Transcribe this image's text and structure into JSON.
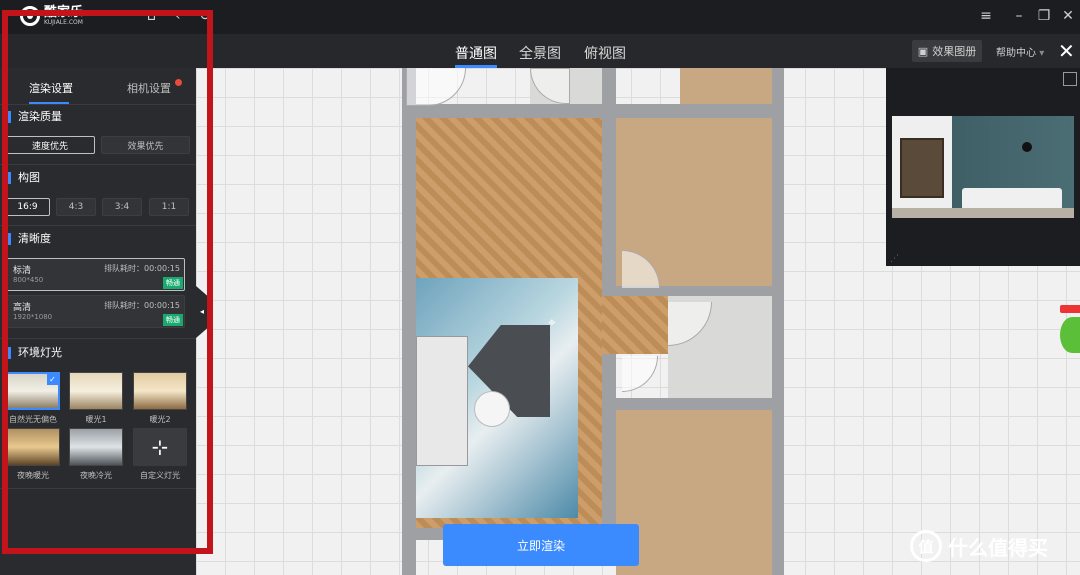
{
  "app": {
    "logo_cn": "酷家乐",
    "logo_en": "KUJIALE.COM"
  },
  "view_tabs": [
    {
      "label": "普通图",
      "active": true
    },
    {
      "label": "全景图",
      "active": false
    },
    {
      "label": "俯视图",
      "active": false
    }
  ],
  "toolbar": {
    "gallery_label": "效果图册",
    "help_label": "帮助中心"
  },
  "panel": {
    "tabs": [
      {
        "label": "渲染设置",
        "active": true
      },
      {
        "label": "相机设置",
        "active": false,
        "has_notification": true
      }
    ],
    "quality": {
      "title": "渲染质量",
      "options": [
        {
          "label": "速度优先",
          "active": true
        },
        {
          "label": "效果优先",
          "active": false
        }
      ]
    },
    "composition": {
      "title": "构图",
      "options": [
        {
          "label": "16:9",
          "active": true
        },
        {
          "label": "4:3",
          "active": false
        },
        {
          "label": "3:4",
          "active": false
        },
        {
          "label": "1:1",
          "active": false
        }
      ]
    },
    "clarity": {
      "title": "清晰度",
      "options": [
        {
          "name": "标清",
          "size": "800*450",
          "queue": "排队耗时：00:00:15",
          "badge": "畅通",
          "active": true
        },
        {
          "name": "高清",
          "size": "1920*1080",
          "queue": "排队耗时：00:00:15",
          "badge": "畅通",
          "active": false
        }
      ]
    },
    "lighting": {
      "title": "环境灯光",
      "options": [
        {
          "label": "自然光无偏色",
          "selected": true
        },
        {
          "label": "暖光1",
          "selected": false
        },
        {
          "label": "暖光2",
          "selected": false
        },
        {
          "label": "夜晚暖光",
          "selected": false
        },
        {
          "label": "夜晚冷光",
          "selected": false
        },
        {
          "label": "自定义灯光",
          "selected": false
        }
      ]
    }
  },
  "render_button": "立即渲染",
  "watermark": {
    "mark": "值",
    "text": "什么值得买"
  },
  "colors": {
    "accent": "#3b8bff",
    "badge": "#1aaa6f",
    "highlight_frame": "#c3131b"
  }
}
